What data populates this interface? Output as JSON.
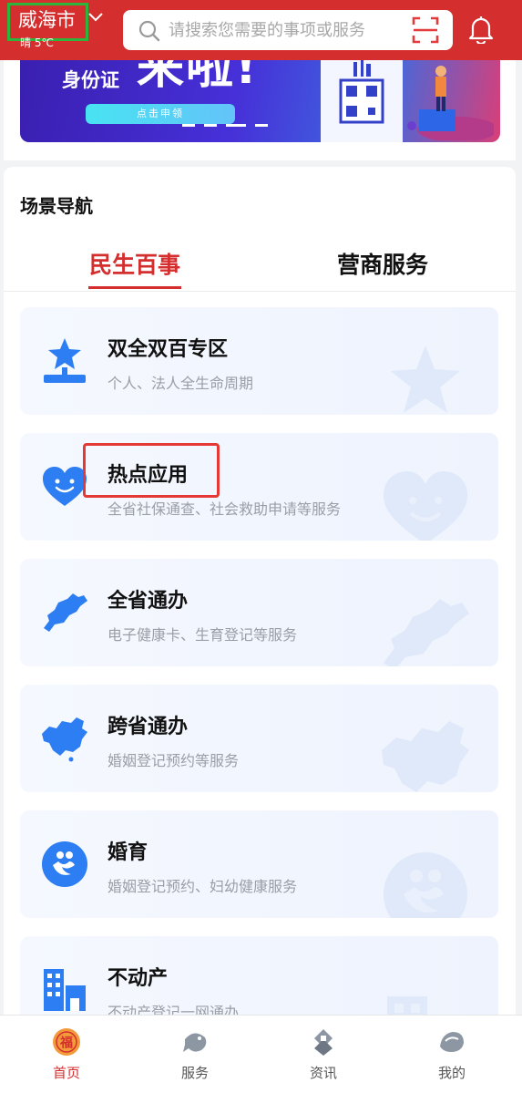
{
  "header": {
    "city": "威海市",
    "weather": "晴 5℃",
    "search_placeholder": "请搜索您需要的事项或服务"
  },
  "banner": {
    "text_id": "身份证",
    "text_big": "来啦!",
    "button": "点击申领"
  },
  "section": {
    "title": "场景导航",
    "tabs": [
      {
        "label": "民生百事",
        "active": true
      },
      {
        "label": "营商服务",
        "active": false
      }
    ]
  },
  "items": [
    {
      "title": "双全双百专区",
      "subtitle": "个人、法人全生命周期",
      "icon": "star-podium-icon"
    },
    {
      "title": "热点应用",
      "subtitle": "全省社保通查、社会救助申请等服务",
      "icon": "heart-smile-icon"
    },
    {
      "title": "全省通办",
      "subtitle": "电子健康卡、生育登记等服务",
      "icon": "shandong-map-icon"
    },
    {
      "title": "跨省通办",
      "subtitle": "婚姻登记预约等服务",
      "icon": "china-map-icon"
    },
    {
      "title": "婚育",
      "subtitle": "婚姻登记预约、妇幼健康服务",
      "icon": "family-icon"
    },
    {
      "title": "不动产",
      "subtitle": "不动产登记一网通办",
      "icon": "building-icon"
    }
  ],
  "bottom_nav": [
    {
      "label": "首页",
      "icon": "home-fu-icon",
      "active": true
    },
    {
      "label": "服务",
      "icon": "service-fish-icon",
      "active": false
    },
    {
      "label": "资讯",
      "icon": "news-icon",
      "active": false
    },
    {
      "label": "我的",
      "icon": "profile-icon",
      "active": false
    }
  ],
  "colors": {
    "brand_red": "#d42e2e",
    "icon_blue": "#2c7ef2",
    "highlight_green": "#2eb43a",
    "highlight_red": "#e53935"
  }
}
